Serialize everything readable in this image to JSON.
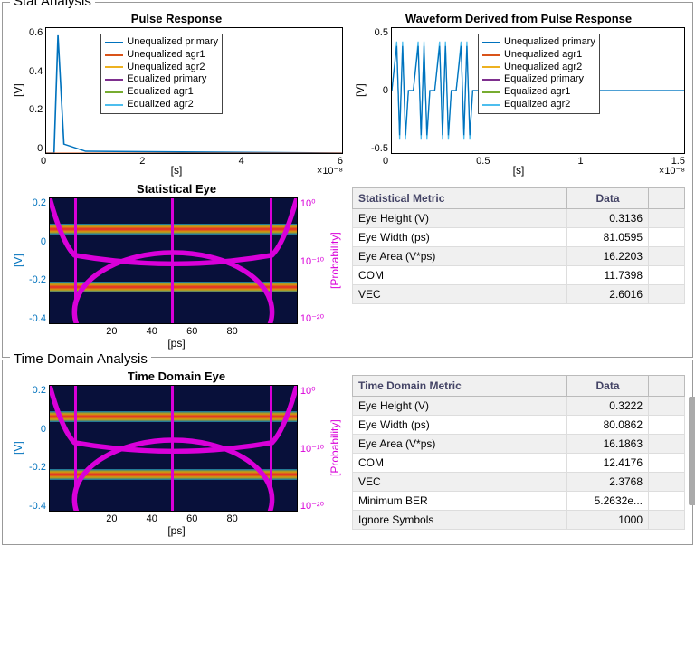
{
  "sections": {
    "stat": {
      "title": "Stat Analysis"
    },
    "time": {
      "title": "Time Domain Analysis"
    }
  },
  "pulse": {
    "title": "Pulse Response",
    "ylabel": "[V]",
    "xlabel": "[s]",
    "xmult": "×10⁻⁸",
    "yticks": [
      "0.6",
      "0.4",
      "0.2",
      "0"
    ],
    "xticks": [
      "0",
      "2",
      "4",
      "6"
    ]
  },
  "waveform": {
    "title": "Waveform Derived from Pulse Response",
    "ylabel": "[V]",
    "xlabel": "[s]",
    "xmult": "×10⁻⁸",
    "yticks": [
      "0.5",
      "0",
      "-0.5"
    ],
    "xticks": [
      "0",
      "0.5",
      "1",
      "1.5"
    ]
  },
  "legend": {
    "items": [
      {
        "label": "Unequalized primary",
        "color": "#0072bd"
      },
      {
        "label": "Unequalized agr1",
        "color": "#d95319"
      },
      {
        "label": "Unequalized agr2",
        "color": "#edb120"
      },
      {
        "label": "Equalized primary",
        "color": "#7e2f8e"
      },
      {
        "label": "Equalized agr1",
        "color": "#77ac30"
      },
      {
        "label": "Equalized agr2",
        "color": "#4dbeee"
      }
    ]
  },
  "stat_eye": {
    "title": "Statistical Eye",
    "ylabel_left": "[V]",
    "ylabel_right": "[Probability]",
    "xlabel": "[ps]",
    "yticks_left": [
      "0.2",
      "0",
      "-0.2",
      "-0.4"
    ],
    "yticks_right": [
      "10⁰",
      "10⁻¹⁰",
      "10⁻²⁰"
    ],
    "xticks": [
      "20",
      "40",
      "60",
      "80"
    ]
  },
  "time_eye": {
    "title": "Time Domain Eye",
    "ylabel_left": "[V]",
    "ylabel_right": "[Probability]",
    "xlabel": "[ps]",
    "yticks_left": [
      "0.2",
      "0",
      "-0.2",
      "-0.4"
    ],
    "yticks_right": [
      "10⁰",
      "10⁻¹⁰",
      "10⁻²⁰"
    ],
    "xticks": [
      "20",
      "40",
      "60",
      "80"
    ]
  },
  "stat_table": {
    "headers": [
      "Statistical Metric",
      "Data"
    ],
    "rows": [
      {
        "metric": "Eye Height (V)",
        "data": "0.3136"
      },
      {
        "metric": "Eye Width (ps)",
        "data": "81.0595"
      },
      {
        "metric": "Eye Area (V*ps)",
        "data": "16.2203"
      },
      {
        "metric": "COM",
        "data": "11.7398"
      },
      {
        "metric": "VEC",
        "data": "2.6016"
      }
    ]
  },
  "time_table": {
    "headers": [
      "Time Domain Metric",
      "Data"
    ],
    "rows": [
      {
        "metric": "Eye Height (V)",
        "data": "0.3222"
      },
      {
        "metric": "Eye Width (ps)",
        "data": "80.0862"
      },
      {
        "metric": "Eye Area (V*ps)",
        "data": "16.1863"
      },
      {
        "metric": "COM",
        "data": "12.4176"
      },
      {
        "metric": "VEC",
        "data": "2.3768"
      },
      {
        "metric": "Minimum BER",
        "data": "5.2632e..."
      },
      {
        "metric": "Ignore Symbols",
        "data": "1000"
      }
    ]
  },
  "chart_data": [
    {
      "type": "line",
      "title": "Pulse Response",
      "xlabel": "[s]",
      "ylabel": "[V]",
      "xlim": [
        0,
        6e-08
      ],
      "ylim": [
        0,
        0.6
      ],
      "series": [
        {
          "name": "Unequalized primary",
          "x": [
            0,
            1e-09,
            2e-09,
            3e-09,
            1e-08,
            6e-08
          ],
          "y": [
            0,
            0.58,
            0.05,
            0.01,
            0,
            0
          ]
        },
        {
          "name": "Unequalized agr1",
          "x": [
            0,
            6e-08
          ],
          "y": [
            0,
            0
          ]
        },
        {
          "name": "Unequalized agr2",
          "x": [
            0,
            6e-08
          ],
          "y": [
            0,
            0
          ]
        },
        {
          "name": "Equalized primary",
          "x": [
            0,
            1e-09,
            2e-09,
            3e-09,
            1e-08,
            6e-08
          ],
          "y": [
            0,
            0.55,
            0.04,
            0.01,
            0,
            0
          ]
        },
        {
          "name": "Equalized agr1",
          "x": [
            0,
            6e-08
          ],
          "y": [
            0,
            0
          ]
        },
        {
          "name": "Equalized agr2",
          "x": [
            0,
            6e-08
          ],
          "y": [
            0,
            0
          ]
        }
      ]
    },
    {
      "type": "line",
      "title": "Waveform Derived from Pulse Response",
      "xlabel": "[s]",
      "ylabel": "[V]",
      "xlim": [
        0,
        1.5e-08
      ],
      "ylim": [
        -0.5,
        0.5
      ],
      "note": "four bursts of bipolar pulses approx ±0.3 V between 0 and 0.35e-8 s, flat ~0 V elsewhere",
      "series_names": [
        "Unequalized primary",
        "Unequalized agr1",
        "Unequalized agr2",
        "Equalized primary",
        "Equalized agr1",
        "Equalized agr2"
      ]
    },
    {
      "type": "heatmap",
      "title": "Statistical Eye",
      "xlabel": "[ps]",
      "ylabel": "[V]",
      "xlim": [
        0,
        100
      ],
      "ylim": [
        -0.4,
        0.3
      ],
      "right_axis": {
        "label": "[Probability]",
        "scale": "log",
        "lim": [
          1e-20,
          1
        ]
      },
      "eye_openings": {
        "height_V": 0.3136,
        "width_ps": 81.0595
      }
    },
    {
      "type": "heatmap",
      "title": "Time Domain Eye",
      "xlabel": "[ps]",
      "ylabel": "[V]",
      "xlim": [
        0,
        100
      ],
      "ylim": [
        -0.4,
        0.3
      ],
      "right_axis": {
        "label": "[Probability]",
        "scale": "log",
        "lim": [
          1e-20,
          1
        ]
      },
      "eye_openings": {
        "height_V": 0.3222,
        "width_ps": 80.0862
      }
    },
    {
      "type": "table",
      "title": "Statistical Metric",
      "rows": [
        [
          "Eye Height (V)",
          0.3136
        ],
        [
          "Eye Width (ps)",
          81.0595
        ],
        [
          "Eye Area (V*ps)",
          16.2203
        ],
        [
          "COM",
          11.7398
        ],
        [
          "VEC",
          2.6016
        ]
      ]
    },
    {
      "type": "table",
      "title": "Time Domain Metric",
      "rows": [
        [
          "Eye Height (V)",
          0.3222
        ],
        [
          "Eye Width (ps)",
          80.0862
        ],
        [
          "Eye Area (V*ps)",
          16.1863
        ],
        [
          "COM",
          12.4176
        ],
        [
          "VEC",
          2.3768
        ],
        [
          "Minimum BER",
          "5.2632e..."
        ],
        [
          "Ignore Symbols",
          1000
        ]
      ]
    }
  ]
}
